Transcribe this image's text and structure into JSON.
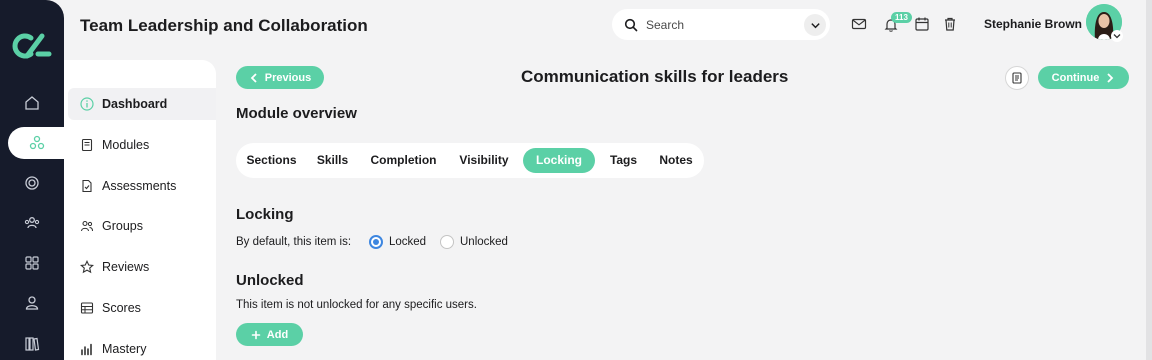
{
  "header": {
    "app_title": "Team Leadership and Collaboration",
    "search_placeholder": "Search",
    "notification_count": "113",
    "user_name": "Stephanie Brown"
  },
  "rail": {
    "icons": [
      "home-icon",
      "network-icon",
      "target-icon",
      "team-icon",
      "grid-icon",
      "user-icon",
      "library-icon"
    ],
    "active": "network-icon"
  },
  "sidebar": {
    "items": [
      {
        "label": "Dashboard",
        "icon": "info-icon",
        "active": true
      },
      {
        "label": "Modules",
        "icon": "book-icon"
      },
      {
        "label": "Assessments",
        "icon": "file-check-icon"
      },
      {
        "label": "Groups",
        "icon": "groups-icon"
      },
      {
        "label": "Reviews",
        "icon": "star-icon"
      },
      {
        "label": "Scores",
        "icon": "table-icon"
      },
      {
        "label": "Mastery",
        "icon": "bar-chart-icon"
      }
    ]
  },
  "main": {
    "previous_label": "Previous",
    "page_title": "Communication skills for leaders",
    "continue_label": "Continue",
    "module_overview": "Module overview",
    "tabs": [
      {
        "label": "Sections"
      },
      {
        "label": "Skills"
      },
      {
        "label": "Completion"
      },
      {
        "label": "Visibility"
      },
      {
        "label": "Locking",
        "active": true
      },
      {
        "label": "Tags"
      },
      {
        "label": "Notes"
      }
    ],
    "locking": {
      "heading": "Locking",
      "default_label": "By default, this item is:",
      "options": [
        {
          "label": "Locked",
          "selected": true
        },
        {
          "label": "Unlocked",
          "selected": false
        }
      ]
    },
    "unlocked": {
      "heading": "Unlocked",
      "text": "This item is not unlocked for any specific users.",
      "add_label": "Add"
    }
  },
  "colors": {
    "accent": "#5bd0a6",
    "rail": "#161b2b",
    "radio_selected": "#3d86e0",
    "background": "#f3f3f4"
  }
}
